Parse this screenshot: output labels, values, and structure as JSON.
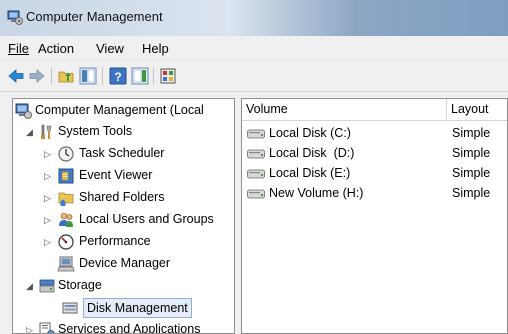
{
  "window": {
    "title": "Computer Management"
  },
  "menu": {
    "file": "File",
    "action": "Action",
    "view": "View",
    "help": "Help"
  },
  "toolbar": {
    "buttons": [
      "back-icon",
      "forward-icon",
      "up-folder-icon",
      "show-hide-tree-icon",
      "help-icon",
      "action-pane-icon",
      "properties-icon"
    ]
  },
  "tree": {
    "root": "Computer Management (Local",
    "system_tools": "System Tools",
    "task_scheduler": "Task Scheduler",
    "event_viewer": "Event Viewer",
    "shared_folders": "Shared Folders",
    "local_users": "Local Users and Groups",
    "performance": "Performance",
    "device_manager": "Device Manager",
    "storage": "Storage",
    "disk_management": "Disk Management",
    "services": "Services and Applications"
  },
  "volumes": {
    "columns": [
      "Volume",
      "Layout"
    ],
    "rows": [
      {
        "name": "Local Disk (C:)",
        "layout": "Simple"
      },
      {
        "name": "Local Disk  (D:)",
        "layout": "Simple"
      },
      {
        "name": "Local Disk (E:)",
        "layout": "Simple"
      },
      {
        "name": "New Volume (H:)",
        "layout": "Simple"
      }
    ]
  }
}
